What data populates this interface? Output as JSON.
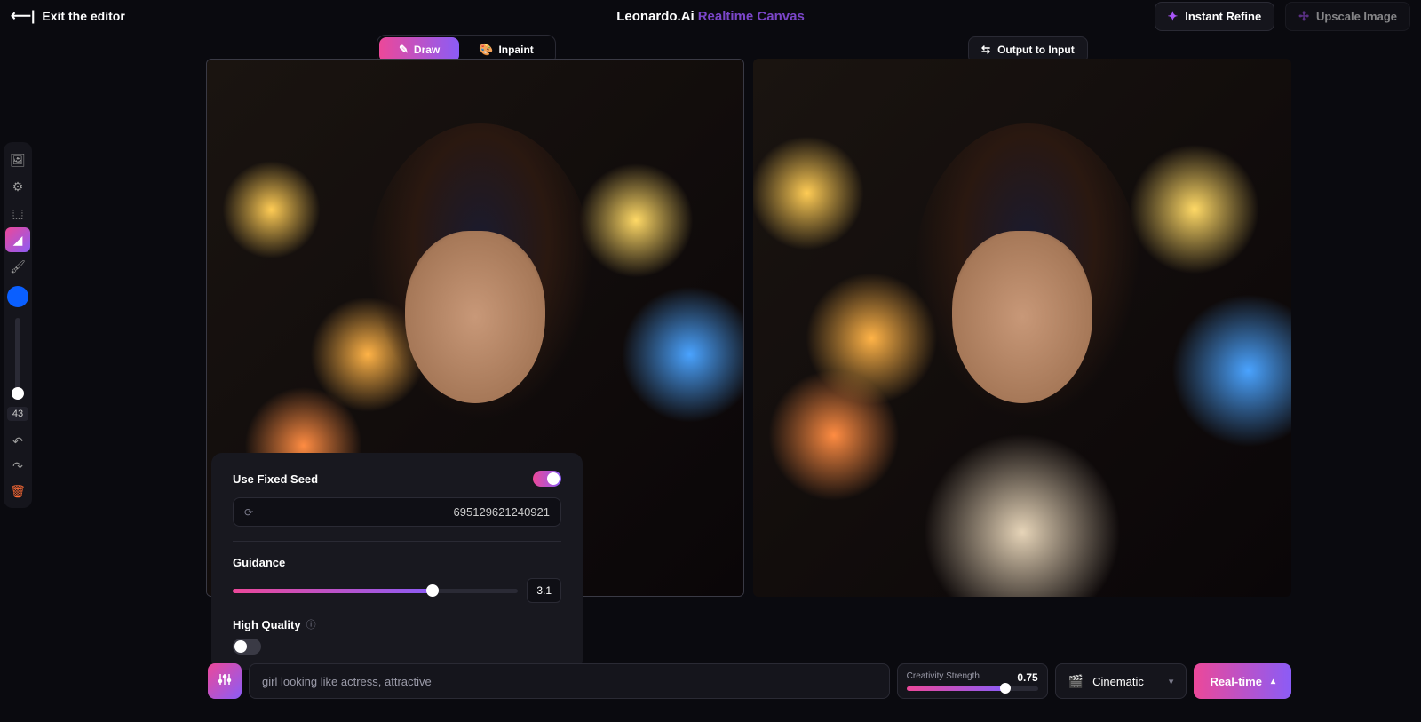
{
  "header": {
    "exit": "Exit the editor",
    "logo_main": "Leonardo.Ai",
    "logo_sub": "Realtime Canvas",
    "instant_refine": "Instant Refine",
    "upscale": "Upscale Image"
  },
  "modes": {
    "draw": "Draw",
    "inpaint": "Inpaint"
  },
  "output_to_input": "Output to Input",
  "toolbar": {
    "brush_size": "43"
  },
  "popup": {
    "use_fixed_seed": "Use Fixed Seed",
    "seed_value": "695129621240921",
    "guidance_label": "Guidance",
    "guidance_value": "3.1",
    "high_quality": "High Quality"
  },
  "bottom": {
    "prompt": "girl looking like actress,  attractive",
    "creativity_label": "Creativity Strength",
    "creativity_value": "0.75",
    "style": "Cinematic",
    "realtime": "Real-time"
  }
}
